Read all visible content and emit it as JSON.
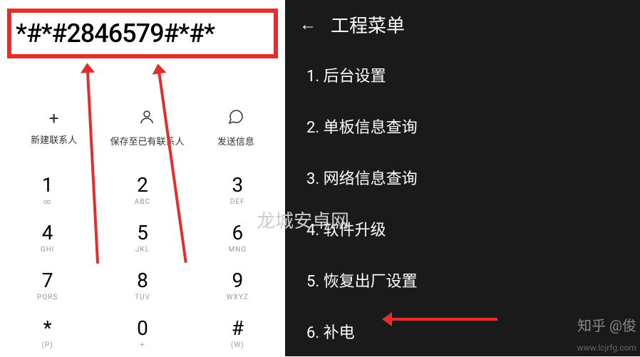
{
  "dialer": {
    "code": "*#*#2846579#*#*",
    "actions": {
      "newContact": "新建联系人",
      "saveToExisting": "保存至已有联系人",
      "sendMessage": "发送信息"
    },
    "keys": [
      {
        "num": "1",
        "sub": "∞"
      },
      {
        "num": "2",
        "sub": "ABC"
      },
      {
        "num": "3",
        "sub": "DEF"
      },
      {
        "num": "4",
        "sub": "GHI"
      },
      {
        "num": "5",
        "sub": "JKL"
      },
      {
        "num": "6",
        "sub": "MNO"
      },
      {
        "num": "7",
        "sub": "PQRS"
      },
      {
        "num": "8",
        "sub": "TUV"
      },
      {
        "num": "9",
        "sub": "WXYZ"
      },
      {
        "num": "*",
        "sub": "(P)"
      },
      {
        "num": "0",
        "sub": "+"
      },
      {
        "num": "#",
        "sub": "(W)"
      }
    ]
  },
  "menu": {
    "title": "工程菜单",
    "items": [
      "1. 后台设置",
      "2. 单板信息查询",
      "3. 网络信息查询",
      "4. 软件升级",
      "5. 恢复出厂设置",
      "6. 补电"
    ]
  },
  "watermarks": {
    "center": "龙城安卓网",
    "right": "知乎 @俊",
    "url": "www.lcjrfg.com"
  }
}
